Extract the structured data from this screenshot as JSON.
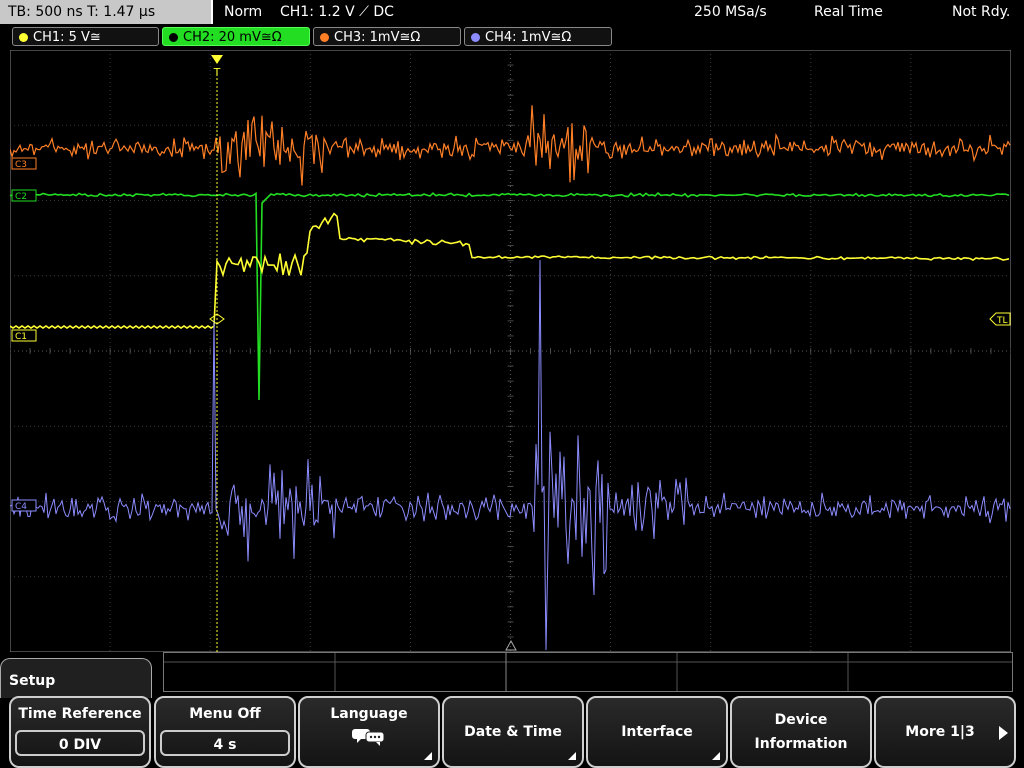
{
  "header": {
    "timebase": "TB: 500 ns   T: 1.47 µs",
    "trigger_mode": "Norm",
    "trigger_info": "CH1: 1.2 V ⟋ DC",
    "sample_rate": "250 MSa/s",
    "acq_mode": "Real Time",
    "status": "Not Rdy."
  },
  "channels": [
    {
      "label": "CH1: 5 V≅",
      "color": "#ffff33"
    },
    {
      "label": "CH2: 20 mV≅Ω",
      "color": "#22dd22"
    },
    {
      "label": "CH3: 1mV≅Ω",
      "color": "#ff7f27"
    },
    {
      "label": "CH4: 1mV≅Ω",
      "color": "#8c8cff"
    }
  ],
  "markers": {
    "ch3": "C3",
    "ch2": "C2",
    "ch1": "C1",
    "ch4": "C4",
    "trigger_level": "TL",
    "trigger_pos": "T"
  },
  "menu": {
    "setup_title": "Setup",
    "time_reference": {
      "label": "Time Reference",
      "value": "0 DIV"
    },
    "menu_off": {
      "label": "Menu Off",
      "value": "4 s"
    },
    "language": {
      "label": "Language"
    },
    "date_time": {
      "label": "Date & Time"
    },
    "interface": {
      "label": "Interface"
    },
    "device_info": {
      "label": "Device\nInformation",
      "line1": "Device",
      "line2": "Information"
    },
    "more": {
      "label": "More 1|3"
    }
  },
  "colors": {
    "grid": "#5a5a5a",
    "ch1": "#ffff33",
    "ch2": "#22dd22",
    "ch3": "#ff7f27",
    "ch4": "#8c8cff"
  }
}
